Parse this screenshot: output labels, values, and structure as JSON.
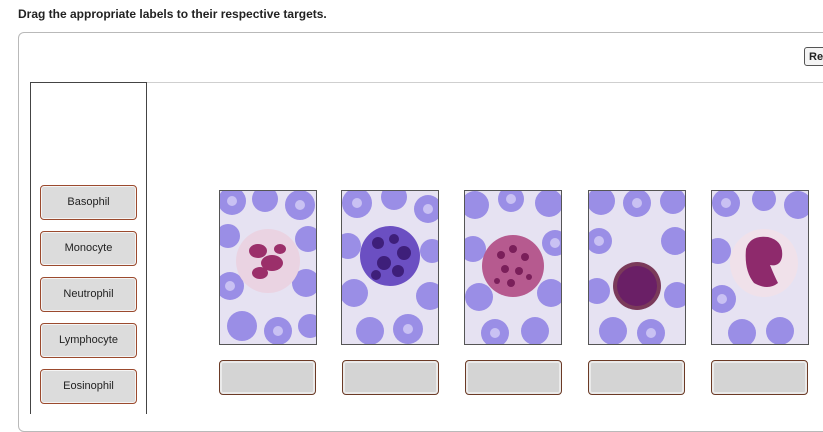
{
  "instructions": "Drag the appropriate labels to their respective targets.",
  "reset_label": "Re",
  "labels": [
    {
      "text": "Basophil"
    },
    {
      "text": "Monocyte"
    },
    {
      "text": "Neutrophil"
    },
    {
      "text": "Lymphocyte"
    },
    {
      "text": "Eosinophil"
    }
  ],
  "images": [
    {
      "icon": "blood-smear-image-1"
    },
    {
      "icon": "blood-smear-image-2"
    },
    {
      "icon": "blood-smear-image-3"
    },
    {
      "icon": "blood-smear-image-4"
    },
    {
      "icon": "blood-smear-image-5"
    }
  ],
  "colors": {
    "rbc": "#9a8ee6",
    "rbc_center": "#c9c1f3",
    "background": "#e3e0ef",
    "nucleus": "#8a2a6e",
    "granule": "#5b1f78",
    "label_border": "#9b4a2e"
  }
}
